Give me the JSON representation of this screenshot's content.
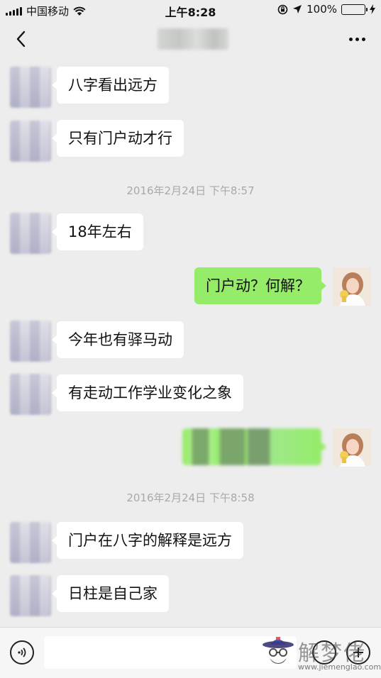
{
  "status_bar": {
    "carrier": "中国移动",
    "time": "上午8:28",
    "battery_percent": "100%"
  },
  "header": {
    "back_icon": "chevron-left-icon",
    "more_icon": "ellipsis-icon"
  },
  "timestamps": [
    "2016年2月24日 下午8:57",
    "2016年2月24日 下午8:58"
  ],
  "messages": [
    {
      "side": "in",
      "text": "八字看出远方"
    },
    {
      "side": "in",
      "text": "只有门户动才行"
    },
    {
      "side": "in",
      "text": "18年左右"
    },
    {
      "side": "out",
      "text": "门户动？何解？"
    },
    {
      "side": "in",
      "text": "今年也有驿马动"
    },
    {
      "side": "in",
      "text": "有走动工作学业变化之象"
    },
    {
      "side": "out",
      "text": ""
    },
    {
      "side": "in",
      "text": "门户在八字的解释是远方"
    },
    {
      "side": "in",
      "text": "日柱是自己家"
    }
  ],
  "input_bar": {
    "voice_icon": "voice-icon",
    "emoji_icon": "emoji-icon",
    "plus_icon": "plus-icon",
    "input_value": ""
  },
  "watermark": {
    "text": "解梦佬",
    "url": "www.jiemenglao.com"
  },
  "colors": {
    "background": "#ededed",
    "incoming_bubble": "#ffffff",
    "outgoing_bubble": "#95ec69",
    "timestamp_text": "#a9a9a9"
  }
}
